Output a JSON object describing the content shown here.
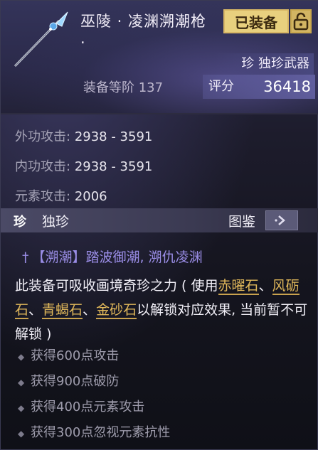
{
  "item": {
    "name": "巫陵 · 凌渊溯潮枪 ·",
    "equipped_badge": "已装备",
    "rarity_type": "珍 独珍武器",
    "equip_level_label": "装备等阶 137",
    "score_label": "评分",
    "score_value": "36418"
  },
  "stats": [
    {
      "label": "外功攻击:",
      "value": "2938 - 3591"
    },
    {
      "label": "内功攻击:",
      "value": "2938 - 3591"
    },
    {
      "label": "元素攻击:",
      "value": "2006"
    }
  ],
  "rarity_section": {
    "emblem": "珍",
    "label": "独珍",
    "atlas_label": "图鉴"
  },
  "effect": {
    "title": "【溯潮】踏波御潮, 溯仇凌渊",
    "desc_prefix": "此装备可吸收画境奇珍之力 ( 使用",
    "stone1": "赤曜石",
    "sep1": "、",
    "stone2": "风砺石",
    "sep2": "、",
    "stone3": "青蝎石",
    "sep3": "、",
    "stone4": "金砂石",
    "desc_suffix": "以解锁对应效果, 当前暂不可解锁 )"
  },
  "bullets": [
    "获得600点攻击",
    "获得900点破防",
    "获得400点元素攻击",
    "获得300点忽视元素抗性"
  ],
  "colors": {
    "gold": "#e1b85a",
    "effect_title": "#9a8de6",
    "badge_bg": "#e8d07e"
  },
  "icons": {
    "weapon": "spear-icon",
    "lock": "unlock-icon",
    "atlas": "arrow-icon",
    "bullet": "diamond-icon",
    "effect": "dagger-icon"
  }
}
